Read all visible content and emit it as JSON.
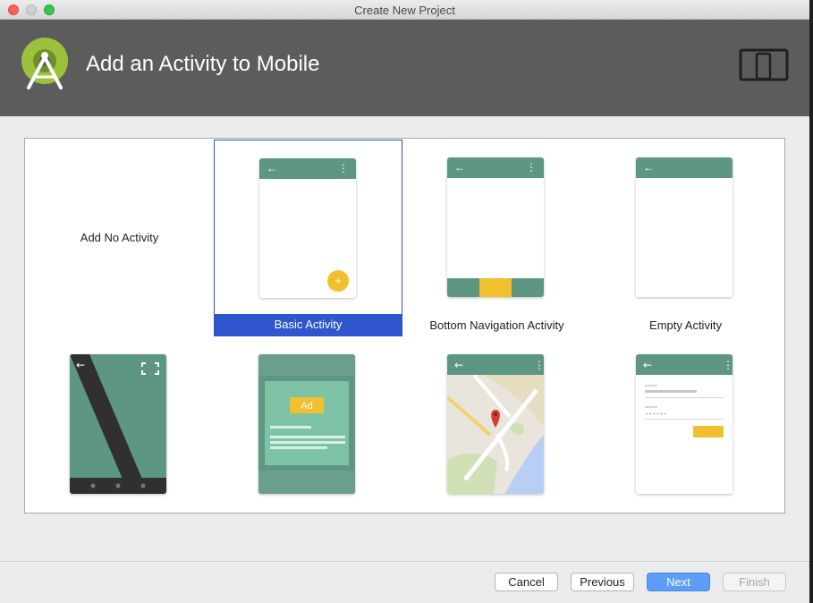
{
  "window": {
    "title": "Create New Project"
  },
  "header": {
    "title": "Add an Activity to Mobile"
  },
  "activities": [
    {
      "label": "Add No Activity",
      "selected": false
    },
    {
      "label": "Basic Activity",
      "selected": true
    },
    {
      "label": "Bottom Navigation Activity",
      "selected": false
    },
    {
      "label": "Empty Activity",
      "selected": false
    },
    {
      "label": "",
      "selected": false
    },
    {
      "label": "",
      "selected": false
    },
    {
      "label": "",
      "selected": false
    },
    {
      "label": "",
      "selected": false
    }
  ],
  "templates": {
    "ad_label": "Ad"
  },
  "buttons": {
    "cancel": "Cancel",
    "previous": "Previous",
    "next": "Next",
    "finish": "Finish"
  },
  "colors": {
    "header": "#5c5c5c",
    "appbar": "#5e9684",
    "accent": "#f0c02f",
    "selection": "#2e56cf",
    "primary_button": "#5c9df8"
  }
}
